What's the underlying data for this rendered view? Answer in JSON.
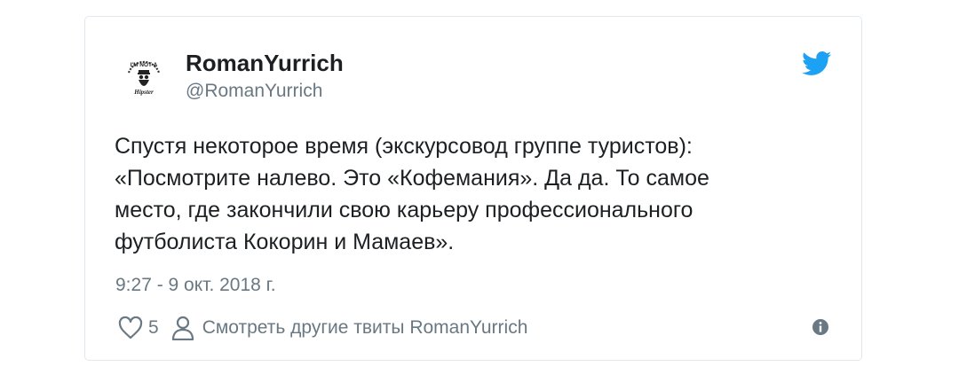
{
  "author": {
    "display_name": "RomanYurrich",
    "handle": "@RomanYurrich",
    "avatar_text_top": "I'M NOT A",
    "avatar_text_bottom": "Hipster"
  },
  "tweet": {
    "lines": [
      "Спустя некоторое время (экскурсовод группе туристов):",
      "«Посмотрите налево. Это «Кофемания». Да да. То самое",
      "место, где закончили свою карьеру профессионального",
      "футболиста Кокорин и Мамаев»."
    ],
    "timestamp": "9:27 - 9 окт. 2018 г."
  },
  "actions": {
    "like_count": "5",
    "profile_link_label": "Смотреть другие твиты RomanYurrich"
  },
  "icons": {
    "brand": "twitter-bird-icon",
    "like": "heart-icon",
    "profile": "person-icon",
    "info": "info-icon"
  },
  "colors": {
    "twitter_blue": "#1da1f2",
    "text_primary": "#1c2022",
    "text_secondary": "#697882",
    "border": "#e1e8ed"
  }
}
